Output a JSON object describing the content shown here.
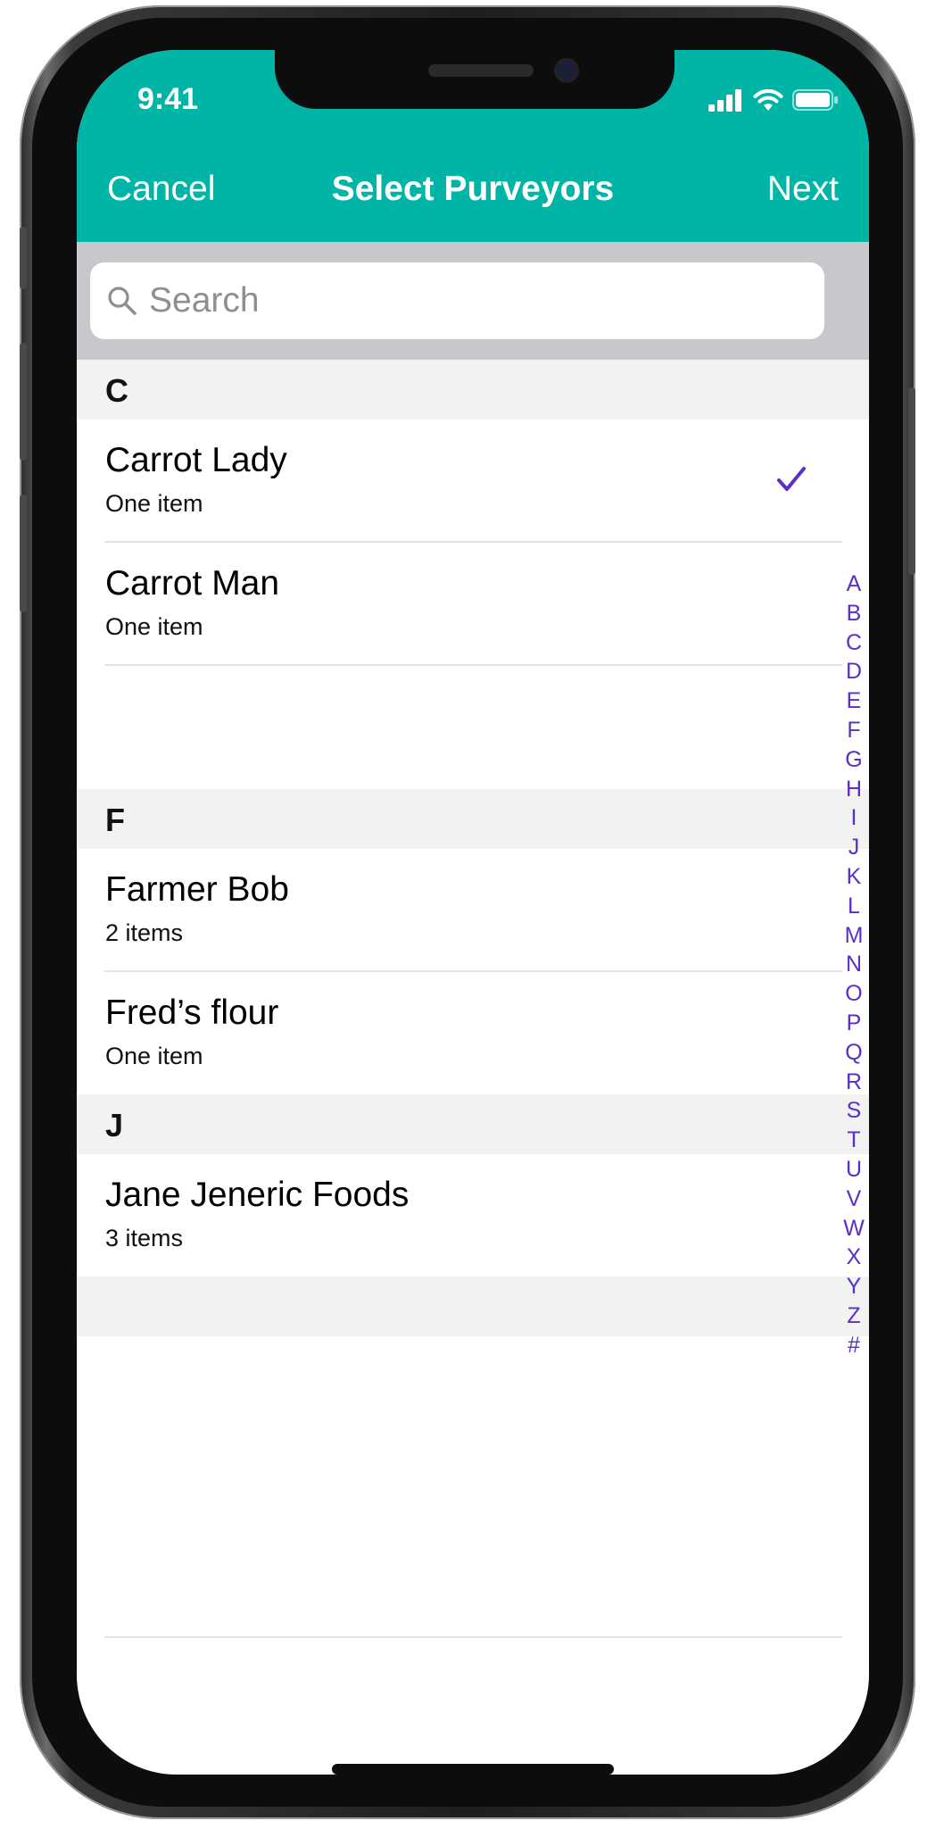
{
  "colors": {
    "accent": "#00b4a6",
    "index_letters": "#5b2ecc",
    "checkmark": "#5b2ecc",
    "section_background": "#f2f2f2",
    "search_background": "#c8c7cc"
  },
  "status_bar": {
    "time": "9:41",
    "icons": [
      "cellular-signal-icon",
      "wifi-icon",
      "battery-icon"
    ]
  },
  "nav": {
    "cancel": "Cancel",
    "title": "Select Purveyors",
    "next": "Next"
  },
  "search": {
    "placeholder": "Search",
    "value": "",
    "icon": "search-icon"
  },
  "sections": [
    {
      "letter": "C",
      "rows": [
        {
          "name": "Carrot Lady",
          "detail": "One item",
          "selected": true
        },
        {
          "name": "Carrot Man",
          "detail": "One item",
          "selected": false
        }
      ]
    },
    {
      "letter": "F",
      "rows": [
        {
          "name": "Farmer Bob",
          "detail": "2 items",
          "selected": false
        },
        {
          "name": "Fred’s flour",
          "detail": "One item",
          "selected": false
        }
      ]
    },
    {
      "letter": "J",
      "rows": [
        {
          "name": "Jane Jeneric Foods",
          "detail": "3 items",
          "selected": false
        }
      ]
    }
  ],
  "index_letters": [
    "A",
    "B",
    "C",
    "D",
    "E",
    "F",
    "G",
    "H",
    "I",
    "J",
    "K",
    "L",
    "M",
    "N",
    "O",
    "P",
    "Q",
    "R",
    "S",
    "T",
    "U",
    "V",
    "W",
    "X",
    "Y",
    "Z",
    "#"
  ]
}
